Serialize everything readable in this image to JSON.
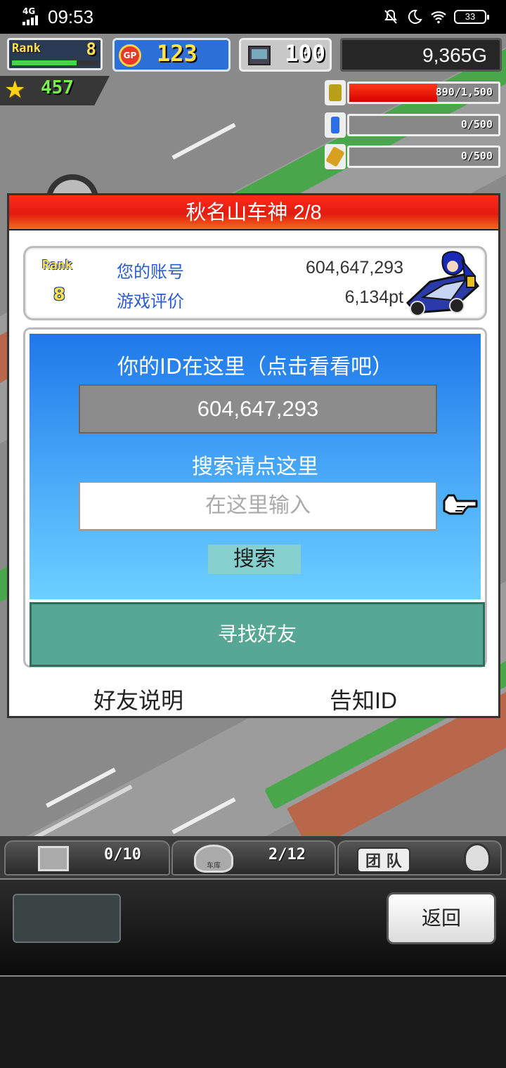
{
  "status_bar": {
    "network": "4G",
    "time": "09:53",
    "battery": "33",
    "icons": [
      "mute-icon",
      "moon-icon",
      "wifi-icon",
      "battery-icon"
    ]
  },
  "hud": {
    "rank_label": "Rank",
    "rank_value": "8",
    "rank_progress": 0.75,
    "gp_icon_text": "GP",
    "gp_value": "123",
    "pc_value": "100",
    "money": "9,365G",
    "stars": "457"
  },
  "resources": [
    {
      "icon": "fuel-barrel-icon",
      "value": "890/1,500",
      "fill": 0.59,
      "color": "#b8a01a"
    },
    {
      "icon": "bottle-icon",
      "value": "0/500",
      "fill": 0,
      "color": "#2a6ee8"
    },
    {
      "icon": "wheat-icon",
      "value": "0/500",
      "fill": 0,
      "color": "#d8a020"
    }
  ],
  "map_icon": {
    "label": "???"
  },
  "modal": {
    "title": "秋名山车神 2/8",
    "rank_label": "Rank",
    "rank_value": "8",
    "account_label": "您的账号",
    "account_value": "604,647,293",
    "rating_label": "游戏评价",
    "rating_value": "6,134pt",
    "id_hint": "你的ID在这里（点击看看吧）",
    "id_value": "604,647,293",
    "search_hint": "搜索请点这里",
    "search_placeholder": "在这里输入",
    "search_button": "搜索",
    "find_friends_button": "寻找好友",
    "friend_help_link": "好友说明",
    "share_id_link": "告知ID"
  },
  "tabs": {
    "storage_count": "0/10",
    "garage_label": "车库",
    "garage_count": "2/12",
    "team_label": "团 队"
  },
  "bottom": {
    "back_button": "返回"
  }
}
